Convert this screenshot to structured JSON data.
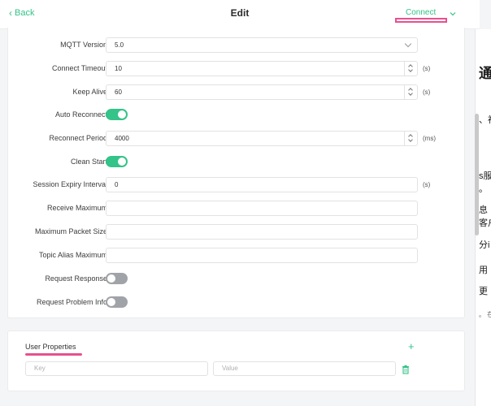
{
  "header": {
    "back_label": "Back",
    "title": "Edit",
    "connect_label": "Connect"
  },
  "form": {
    "mqtt_version": {
      "label": "MQTT Version",
      "value": "5.0"
    },
    "connect_timeout": {
      "label": "Connect Timeout",
      "value": "10",
      "unit": "(s)"
    },
    "keep_alive": {
      "label": "Keep Alive",
      "value": "60",
      "unit": "(s)"
    },
    "auto_reconnect": {
      "label": "Auto Reconnect",
      "state": "on"
    },
    "reconnect_period": {
      "label": "Reconnect Period",
      "value": "4000",
      "unit": "(ms)"
    },
    "clean_start": {
      "label": "Clean Start",
      "state": "on"
    },
    "session_expiry": {
      "label": "Session Expiry Interval",
      "value": "0",
      "unit": "(s)"
    },
    "receive_maximum": {
      "label": "Receive Maximum",
      "value": ""
    },
    "maximum_packet_size": {
      "label": "Maximum Packet Size",
      "value": ""
    },
    "topic_alias_maximum": {
      "label": "Topic Alias Maximum",
      "value": ""
    },
    "request_response": {
      "label": "Request Response",
      "state": "off"
    },
    "request_problem_info": {
      "label": "Request Problem Info",
      "state": "off"
    }
  },
  "user_properties": {
    "title": "User Properties",
    "key_placeholder": "Key",
    "value_placeholder": "Value"
  },
  "side_panel": {
    "fragments": [
      "通",
      "、社",
      "s服",
      "。",
      "息",
      "客户",
      "分i",
      "用",
      "更",
      "。 在"
    ]
  },
  "colors": {
    "accent": "#34c388",
    "highlight": "#e8508f",
    "toggle_off": "#a0a3a8"
  }
}
